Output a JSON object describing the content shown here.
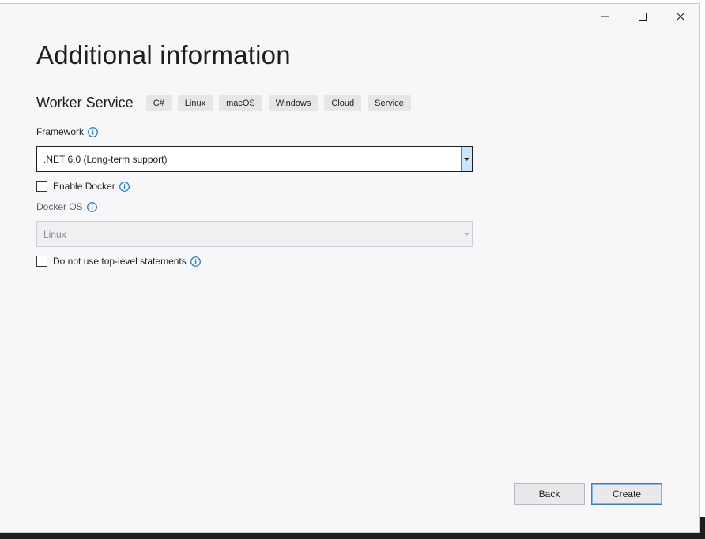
{
  "dialog": {
    "title": "Additional information",
    "template": {
      "name": "Worker Service",
      "tags": [
        "C#",
        "Linux",
        "macOS",
        "Windows",
        "Cloud",
        "Service"
      ]
    },
    "framework": {
      "label": "Framework",
      "selected": ".NET 6.0 (Long-term support)"
    },
    "enable_docker": {
      "label": "Enable Docker",
      "checked": false
    },
    "docker_os": {
      "label": "Docker OS",
      "selected": "Linux",
      "disabled": true
    },
    "top_level_statements": {
      "label": "Do not use top-level statements",
      "checked": false
    },
    "buttons": {
      "back": "Back",
      "create": "Create"
    }
  },
  "colors": {
    "dialog_bg": "#f7f7f9",
    "accent": "#3c7fb1",
    "info_icon": "#1c74b8",
    "tag_bg": "#e6e6e9"
  },
  "icons": {
    "minimize": "minimize-icon",
    "maximize": "maximize-icon",
    "close": "close-icon",
    "info": "info-icon",
    "dropdown": "chevron-down-icon"
  }
}
